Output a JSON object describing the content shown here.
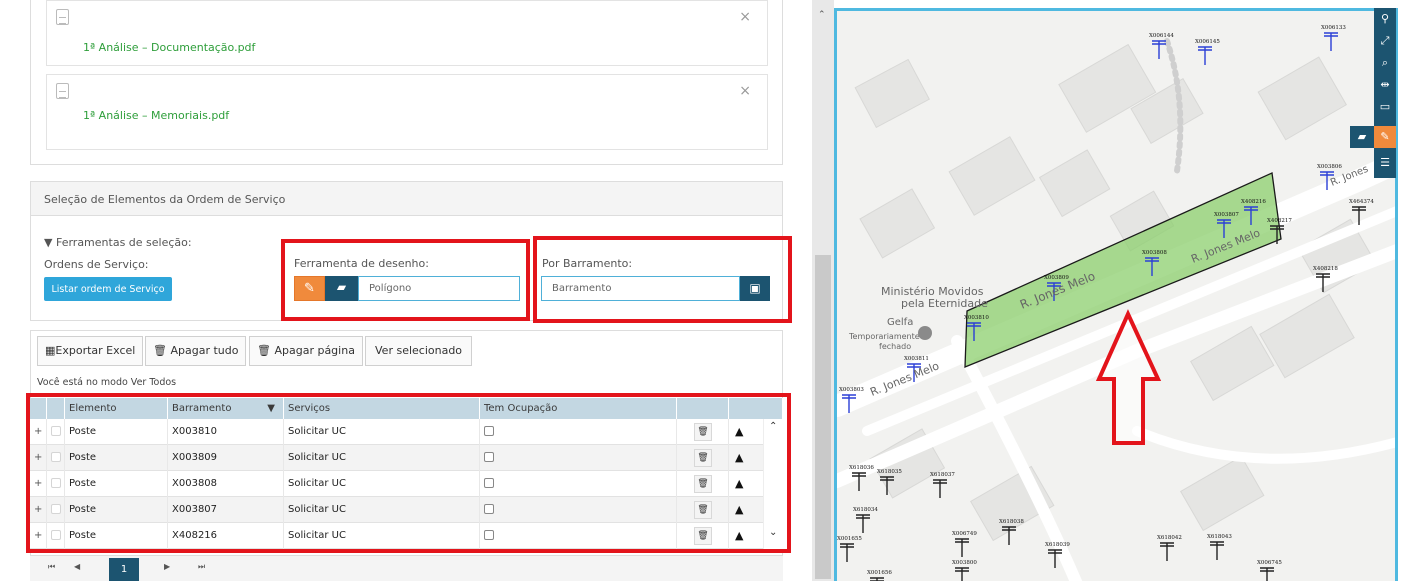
{
  "attachments": [
    {
      "name": "1ª Análise – Documentação.pdf",
      "close": "×"
    },
    {
      "name": "1ª Análise – Memoriais.pdf",
      "close": "×"
    }
  ],
  "selection": {
    "title": "Seleção de Elementos da Ordem de Serviço",
    "tools_label": "Ferramentas de seleção:",
    "orders_label": "Ordens de Serviço:",
    "list_button": "Listar ordem de Serviço",
    "drawing_label": "Ferramenta de desenho:",
    "drawing_value": "Polígono",
    "bus_label": "Por Barramento:",
    "bus_placeholder": "Barramento"
  },
  "toolbar": {
    "export": "Exportar Excel",
    "delete_all": "Apagar tudo",
    "delete_page": "Apagar página",
    "show_selected": "Ver selecionado"
  },
  "mode_text": "Você está no modo Ver Todos",
  "grid": {
    "headers": [
      "Elemento",
      "Barramento",
      "Serviços",
      "Tem Ocupação"
    ],
    "rows": [
      {
        "elemento": "Poste",
        "barramento": "X003810",
        "servico": "Solicitar UC"
      },
      {
        "elemento": "Poste",
        "barramento": "X003809",
        "servico": "Solicitar UC"
      },
      {
        "elemento": "Poste",
        "barramento": "X003808",
        "servico": "Solicitar UC"
      },
      {
        "elemento": "Poste",
        "barramento": "X003807",
        "servico": "Solicitar UC"
      },
      {
        "elemento": "Poste",
        "barramento": "X408216",
        "servico": "Solicitar UC"
      }
    ]
  },
  "pager": {
    "current": "1"
  },
  "map": {
    "streets": [
      "R. Jones Melo",
      "R. Jones Melo",
      "R. Jones Melo",
      "R. Jones",
      "R. Jones Melo"
    ],
    "places": [
      "Ministério Movidos",
      "pela Eternidade",
      "Gelfa",
      "Temporariamente",
      "fechado"
    ],
    "poles": [
      "X006144",
      "X006145",
      "X006133",
      "X003806",
      "X464374",
      "X408216",
      "X003807",
      "X408217",
      "X003808",
      "X408218",
      "X003809",
      "X003810",
      "X003811",
      "X003803",
      "X618036",
      "X618035",
      "X618037",
      "X618034",
      "X618038",
      "X006749",
      "X001655",
      "X618039",
      "X003800",
      "X618042",
      "X618043",
      "X006745",
      "X001656"
    ]
  },
  "colors": {
    "accent": "#1c5470",
    "orange": "#f08a3c",
    "highlight": "#e3141b",
    "link": "#2e9e3a",
    "polygon": "#8ccf6e"
  }
}
